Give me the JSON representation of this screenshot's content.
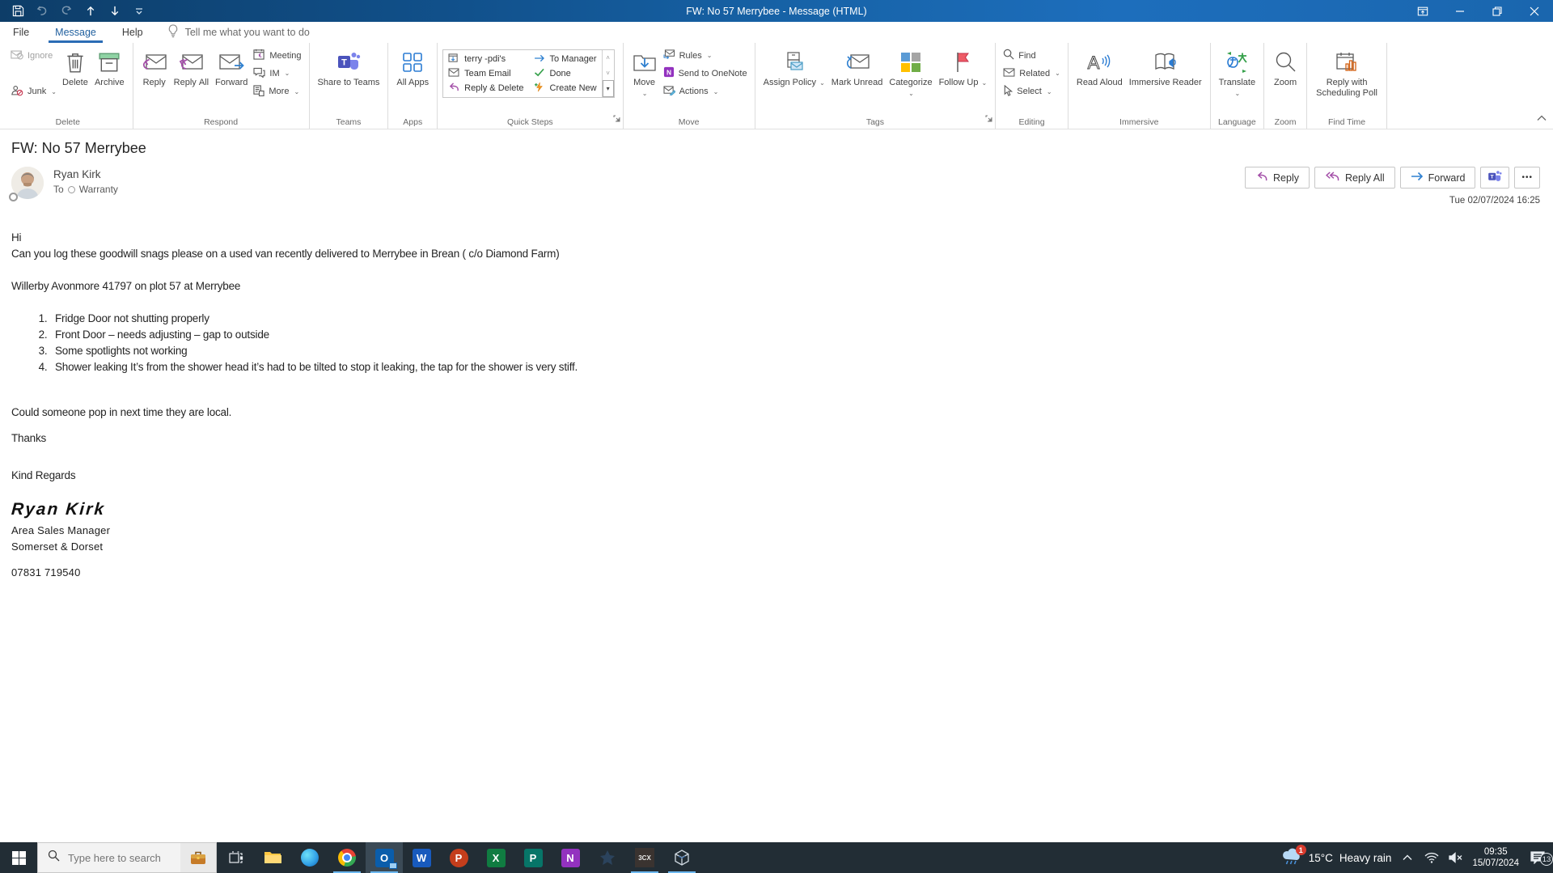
{
  "titlebar": {
    "title": "FW: No 57 Merrybee   -   Message (HTML)"
  },
  "tabs": [
    {
      "label": "File"
    },
    {
      "label": "Message"
    },
    {
      "label": "Help"
    }
  ],
  "tellme": "Tell me what you want to do",
  "ribbon": {
    "delete_group": {
      "label": "Delete",
      "ignore": "Ignore",
      "junk": "Junk",
      "del": "Delete",
      "archive": "Archive"
    },
    "respond_group": {
      "label": "Respond",
      "reply": "Reply",
      "reply_all": "Reply All",
      "forward": "Forward",
      "meeting": "Meeting",
      "im": "IM",
      "more": "More"
    },
    "teams_group": {
      "label": "Teams",
      "share": "Share to Teams"
    },
    "apps_group": {
      "label": "Apps",
      "all_apps": "All Apps"
    },
    "quick_steps": {
      "label": "Quick Steps",
      "items": [
        "terry -pdi's",
        "Team Email",
        "Reply & Delete",
        "To Manager",
        "Done",
        "Create New"
      ]
    },
    "move_group": {
      "label": "Move",
      "move": "Move",
      "rules": "Rules",
      "onenote": "Send to OneNote",
      "actions": "Actions"
    },
    "tags_group": {
      "label": "Tags",
      "assign_policy": "Assign Policy",
      "mark_unread": "Mark Unread",
      "categorize": "Categorize",
      "follow_up": "Follow Up"
    },
    "editing_group": {
      "label": "Editing",
      "find": "Find",
      "related": "Related",
      "select": "Select"
    },
    "immersive_group": {
      "label": "Immersive",
      "read_aloud": "Read Aloud",
      "immersive_reader": "Immersive Reader"
    },
    "language_group": {
      "label": "Language",
      "translate": "Translate"
    },
    "zoom_group": {
      "label": "Zoom",
      "zoom": "Zoom"
    },
    "findtime_group": {
      "label": "Find Time",
      "scheduling_poll": "Reply with Scheduling Poll"
    }
  },
  "message": {
    "subject": "FW: No 57 Merrybee",
    "sender": "Ryan Kirk",
    "to_label": "To",
    "recipient": "Warranty",
    "actions": {
      "reply": "Reply",
      "reply_all": "Reply All",
      "forward": "Forward",
      "more": "•••"
    },
    "date": "Tue 02/07/2024 16:25",
    "body": {
      "greeting": "Hi",
      "p1": "Can you log these goodwill snags please on a used van recently delivered to Merrybee in Brean ( c/o Diamond Farm)",
      "p2": "Willerby Avonmore 41797 on plot 57 at Merrybee",
      "list": [
        "Fridge Door not shutting properly",
        "Front Door – needs adjusting – gap to outside",
        "Some spotlights not working",
        "Shower leaking It’s from the shower head it’s had to be tilted to stop it leaking, the tap for the shower is very stiff."
      ],
      "p3": "Could someone pop in next time they are local.",
      "p4": "Thanks",
      "p5": "Kind Regards"
    },
    "signature": {
      "name": "Ryan  Kirk",
      "role": "Area Sales Manager",
      "region": "Somerset & Dorset",
      "phone": "07831 719540"
    }
  },
  "taskbar": {
    "search_placeholder": "Type here to search",
    "app_letters": {
      "outlook": "O",
      "word": "W",
      "powerpoint": "P",
      "excel": "X",
      "publisher": "P",
      "onenote": "N",
      "threecx": "3CX"
    },
    "tray": {
      "weather_badge": "1",
      "temperature": "15°C",
      "condition": "Heavy rain",
      "time": "09:35",
      "date": "15/07/2024",
      "notification_count": "13"
    }
  },
  "colors": {
    "titlebar_blue": "#1763a8",
    "accent_blue": "#2b6cb5",
    "arrow_purple": "#a34fa8",
    "arrow_blue": "#2f80d0",
    "flag_red": "#e8485c",
    "check_green": "#107c41",
    "taskbar_dark": "#222d35",
    "running_underline": "#6cb8f0"
  }
}
